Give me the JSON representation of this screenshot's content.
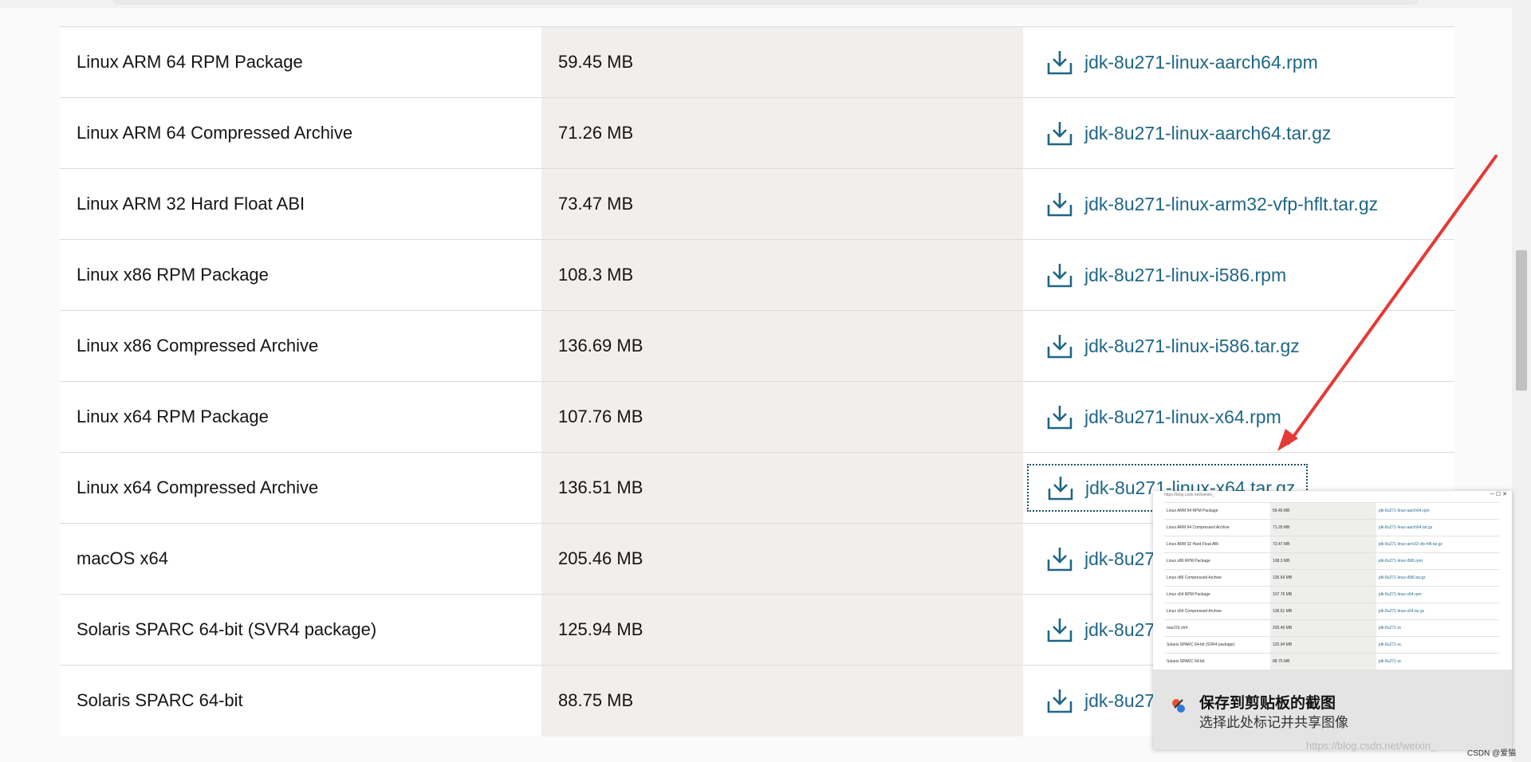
{
  "downloads": [
    {
      "product": "Linux ARM 64 RPM Package",
      "size": "59.45 MB",
      "file": "jdk-8u271-linux-aarch64.rpm"
    },
    {
      "product": "Linux ARM 64 Compressed Archive",
      "size": "71.26 MB",
      "file": "jdk-8u271-linux-aarch64.tar.gz"
    },
    {
      "product": "Linux ARM 32 Hard Float ABI",
      "size": "73.47 MB",
      "file": "jdk-8u271-linux-arm32-vfp-hflt.tar.gz"
    },
    {
      "product": "Linux x86 RPM Package",
      "size": "108.3 MB",
      "file": "jdk-8u271-linux-i586.rpm"
    },
    {
      "product": "Linux x86 Compressed Archive",
      "size": "136.69 MB",
      "file": "jdk-8u271-linux-i586.tar.gz"
    },
    {
      "product": "Linux x64 RPM Package",
      "size": "107.76 MB",
      "file": "jdk-8u271-linux-x64.rpm"
    },
    {
      "product": "Linux x64 Compressed Archive",
      "size": "136.51 MB",
      "file": "jdk-8u271-linux-x64.tar.gz"
    },
    {
      "product": "macOS x64",
      "size": "205.46 MB",
      "file": "jdk-8u271-m"
    },
    {
      "product": "Solaris SPARC 64-bit (SVR4 package)",
      "size": "125.94 MB",
      "file": "jdk-8u271-sc"
    },
    {
      "product": "Solaris SPARC 64-bit",
      "size": "88.75 MB",
      "file": "jdk-8u271-sc"
    }
  ],
  "focused_row": 6,
  "icons": {
    "download": "download-icon",
    "snip": "snipping-tool-icon"
  },
  "colors": {
    "link": "#1e6686",
    "size_column_bg": "#f1efed",
    "arrow": "#e53935"
  },
  "notification": {
    "title": "保存到剪贴板的截图",
    "subtitle": "选择此处标记并共享图像"
  },
  "watermark": "https://blog.csdn.net/weixin_",
  "watermark_tag": "CSDN @爱猫"
}
